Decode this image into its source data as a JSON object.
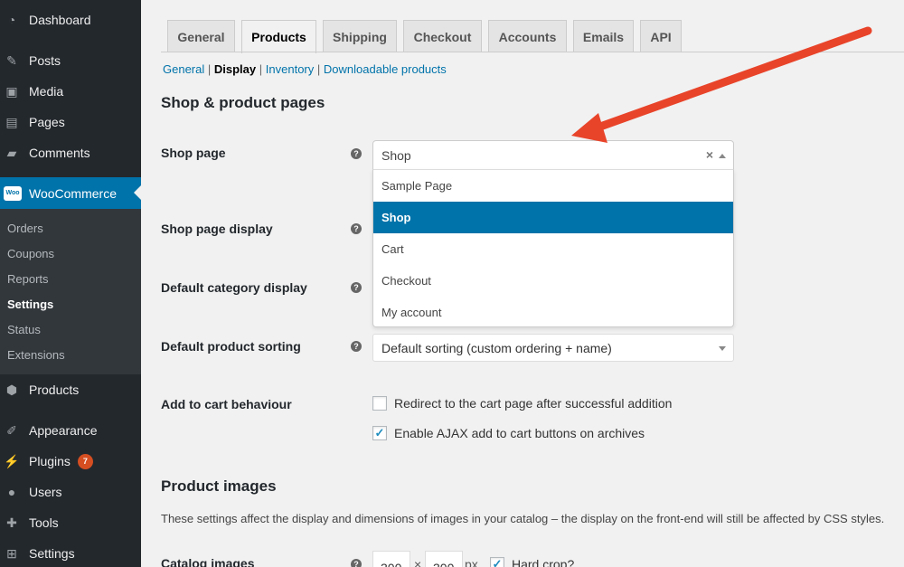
{
  "sidebar": {
    "items": [
      {
        "label": "Dashboard",
        "icon": "dashboard-icon"
      },
      {
        "label": "Posts",
        "icon": "pin-icon"
      },
      {
        "label": "Media",
        "icon": "media-icon"
      },
      {
        "label": "Pages",
        "icon": "pages-icon"
      },
      {
        "label": "Comments",
        "icon": "comment-icon"
      },
      {
        "label": "WooCommerce",
        "icon": "woo-icon"
      },
      {
        "label": "Products",
        "icon": "box-icon"
      },
      {
        "label": "Appearance",
        "icon": "brush-icon"
      },
      {
        "label": "Plugins",
        "icon": "plug-icon",
        "badge": "7"
      },
      {
        "label": "Users",
        "icon": "user-icon"
      },
      {
        "label": "Tools",
        "icon": "wrench-icon"
      },
      {
        "label": "Settings",
        "icon": "sliders-icon"
      }
    ],
    "woo_icon_text": "Woo",
    "submenu": [
      "Orders",
      "Coupons",
      "Reports",
      "Settings",
      "Status",
      "Extensions"
    ]
  },
  "tabs": [
    "General",
    "Products",
    "Shipping",
    "Checkout",
    "Accounts",
    "Emails",
    "API"
  ],
  "subnav": {
    "general": "General",
    "sep": "|",
    "display": "Display",
    "inventory": "Inventory",
    "downloadable": "Downloadable products"
  },
  "section1_title": "Shop & product pages",
  "labels": {
    "shop_page": "Shop page",
    "shop_page_display": "Shop page display",
    "default_category_display": "Default category display",
    "default_product_sorting": "Default product sorting",
    "add_to_cart": "Add to cart behaviour",
    "catalog_images": "Catalog images"
  },
  "help_glyph": "?",
  "shop_select": {
    "value": "Shop",
    "clear": "×",
    "options": [
      "Sample Page",
      "Shop",
      "Cart",
      "Checkout",
      "My account"
    ],
    "selected_index": 1
  },
  "sort_select_value": "Default sorting (custom ordering + name)",
  "checkboxes": {
    "redirect": {
      "label": "Redirect to the cart page after successful addition",
      "checked": false
    },
    "ajax": {
      "label": "Enable AJAX add to cart buttons on archives",
      "checked": true
    }
  },
  "check_mark": "✓",
  "section2_title": "Product images",
  "section2_desc": "These settings affect the display and dimensions of images in your catalog – the display on the front-end will still be affected by CSS styles.",
  "catalog": {
    "width": "300",
    "x": "×",
    "height": "300",
    "unit": "px",
    "hard_crop": "Hard crop?"
  },
  "colors": {
    "accent": "#0073aa",
    "sidebar": "#23282d",
    "annotation_arrow": "#e8442a"
  }
}
